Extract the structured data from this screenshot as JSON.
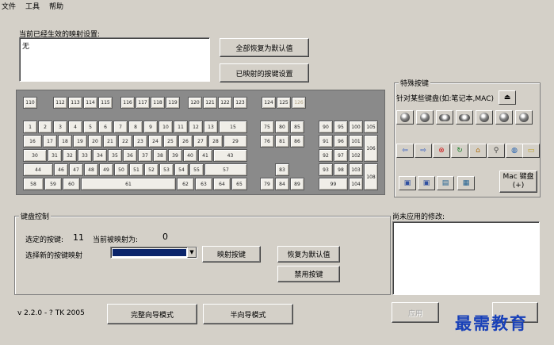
{
  "menu": [
    "文件",
    "工具",
    "帮助"
  ],
  "current_mappings": {
    "label": "当前已经生效的映射设置:",
    "value": "无"
  },
  "buttons": {
    "restore_all": "全部恢复为默认值",
    "mapped_settings": "已映射的按键设置",
    "map_key": "映射按键",
    "restore_default": "恢复为默认值",
    "disable_key": "禁用按键",
    "wizard_full": "完整向导模式",
    "wizard_half": "半向导模式",
    "apply": "应用",
    "mac_keyboard": "Mac 键盘\n(+)"
  },
  "special_keys": {
    "title": "特殊按键",
    "subtitle": "针对某些键盘(如:笔记本,MAC)"
  },
  "keyboard_control": {
    "title": "键盘控制",
    "selected_key_label": "选定的按键:",
    "selected_key_value": "11",
    "currently_mapped_label": "当前被映射为:",
    "currently_mapped_value": "0",
    "choose_new_label": "选择新的按键映射"
  },
  "pending": {
    "label": "尚未应用的修改:"
  },
  "version": "v 2.2.0 - ? TK 2005",
  "watermark": "最需教育",
  "keys": {
    "fn_row_a": [
      "110"
    ],
    "fn_row_b": [
      "112",
      "113",
      "114",
      "115"
    ],
    "fn_row_c": [
      "116",
      "117",
      "118",
      "119"
    ],
    "fn_row_d": [
      "120",
      "121",
      "122",
      "123"
    ],
    "fn_row_e": [
      "124",
      "125",
      "126"
    ],
    "row1": [
      "1",
      "2",
      "3",
      "4",
      "5",
      "6",
      "7",
      "8",
      "9",
      "10",
      "11",
      "12",
      "13",
      "15"
    ],
    "row2": [
      "16",
      "17",
      "18",
      "19",
      "20",
      "21",
      "22",
      "23",
      "24",
      "25",
      "26",
      "27",
      "28",
      "29"
    ],
    "row3": [
      "30",
      "31",
      "32",
      "33",
      "34",
      "35",
      "36",
      "37",
      "38",
      "39",
      "40",
      "41",
      "43"
    ],
    "row4": [
      "44",
      "46",
      "47",
      "48",
      "49",
      "50",
      "51",
      "52",
      "53",
      "54",
      "55",
      "57"
    ],
    "row5": [
      "58",
      "59",
      "60",
      "61",
      "62",
      "63",
      "64",
      "65"
    ],
    "nav1": [
      "75",
      "80",
      "85"
    ],
    "nav2": [
      "76",
      "81",
      "86"
    ],
    "nav_up": "83",
    "nav_bottom": [
      "79",
      "84",
      "89"
    ],
    "num1": [
      "90",
      "95",
      "100",
      "105"
    ],
    "num2": [
      "91",
      "96",
      "101"
    ],
    "num3": [
      "92",
      "97",
      "102"
    ],
    "num4": [
      "93",
      "98",
      "103"
    ],
    "num5": [
      "99",
      "104"
    ],
    "num_plus": "106",
    "num_enter": "108"
  }
}
